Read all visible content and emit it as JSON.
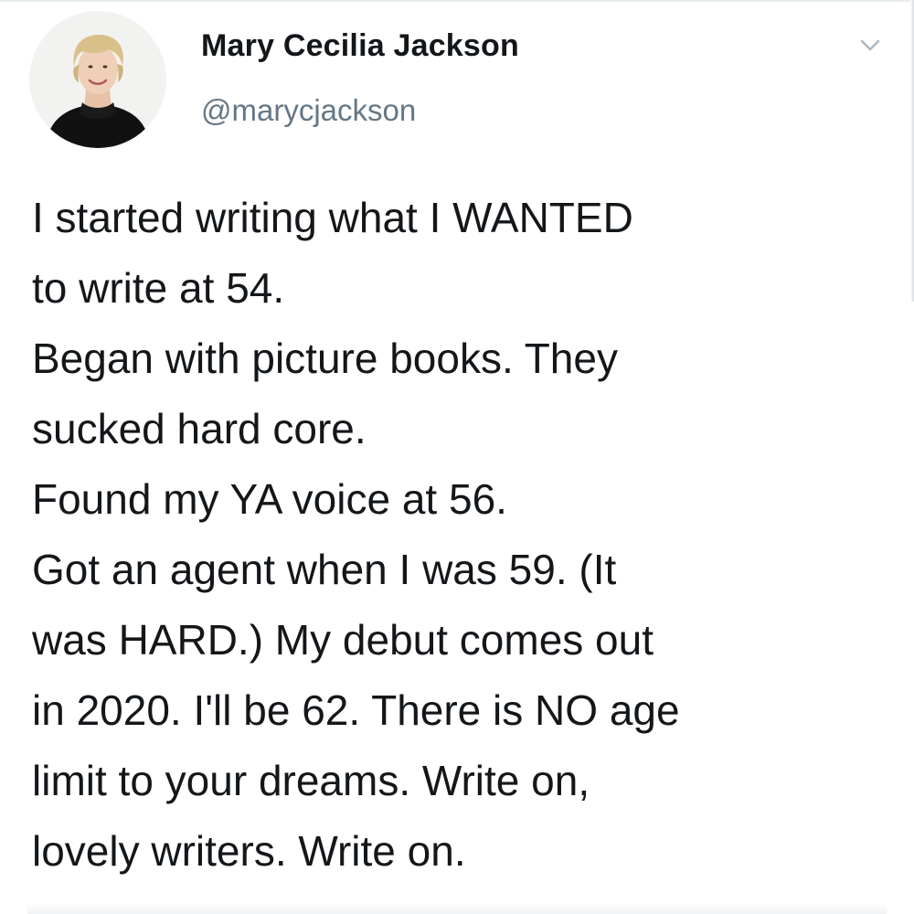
{
  "tweet": {
    "author": {
      "display_name": "Mary Cecilia Jackson",
      "handle": "@marycjackson",
      "avatar_icon": "profile-photo"
    },
    "menu_icon": "chevron-down-icon",
    "text_lines": [
      "I started writing what I WANTED",
      "to write at 54.",
      "Began with picture books. They",
      "sucked hard core.",
      "Found my YA voice at 56.",
      "Got an agent when I was 59. (It",
      "was HARD.) My debut comes out",
      "in 2020. I'll be 62. There is NO age",
      "limit to your dreams. Write on,",
      "lovely writers. Write on."
    ]
  },
  "colors": {
    "text_primary": "#14171a",
    "text_secondary": "#657786",
    "background": "#ffffff",
    "chevron": "#aab8c2"
  }
}
